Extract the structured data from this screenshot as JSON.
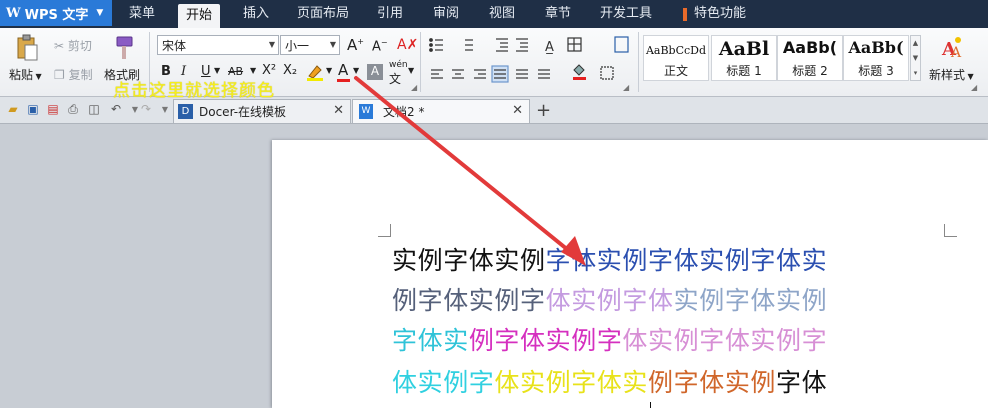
{
  "app": {
    "logo": "W",
    "name": "WPS 文字"
  },
  "menu": {
    "tabs": [
      "菜单",
      "开始",
      "插入",
      "页面布局",
      "引用",
      "审阅",
      "视图",
      "章节",
      "开发工具",
      "特色功能"
    ],
    "active": "开始"
  },
  "ribbon": {
    "clipboard": {
      "paste": "粘贴",
      "cut": "剪切",
      "copy": "复制",
      "format_painter": "格式刷"
    },
    "font": {
      "name": "宋体",
      "size": "小一",
      "bold": "B",
      "italic": "I",
      "underline": "U",
      "strike": "AB",
      "superscript": "X²",
      "subscript": "X₂",
      "font_color": "A",
      "char_shading": "A",
      "phonetic": "wén"
    },
    "styles": [
      {
        "sample": "AaBbCcDd",
        "name": "正文"
      },
      {
        "sample": "AaBl",
        "name": "标题 1"
      },
      {
        "sample": "AaBb(",
        "name": "标题 2"
      },
      {
        "sample": "AaBb(",
        "name": "标题 3"
      }
    ],
    "new_style": "新样式",
    "accent_color": "#2a7ad8"
  },
  "annotation": "点击这里就选择颜色",
  "doc_tabs": [
    {
      "label": "Docer-在线模板",
      "icon": "docer-icon"
    },
    {
      "label": "文档2 *",
      "icon": "word-doc-icon"
    }
  ],
  "document": {
    "lines": [
      [
        {
          "t": "实例字体实例",
          "c": "#111111"
        },
        {
          "t": "字体实例字体实例字体实",
          "c": "#2b4fb0"
        }
      ],
      [
        {
          "t": "例字体实例字",
          "c": "#55607a"
        },
        {
          "t": "体实例字体",
          "c": "#c49be0"
        },
        {
          "t": "实例字体实例",
          "c": "#8ea5c8"
        }
      ],
      [
        {
          "t": "字体实",
          "c": "#2fc3d8"
        },
        {
          "t": "例字体实例字",
          "c": "#d52fbf"
        },
        {
          "t": "体实例字体实例字",
          "c": "#d78fd5"
        }
      ],
      [
        {
          "t": "体实例字",
          "c": "#2fd0e0"
        },
        {
          "t": "体实例字体实",
          "c": "#e8e21a"
        },
        {
          "t": "例字体实例",
          "c": "#d0662a"
        },
        {
          "t": "字体",
          "c": "#111111"
        }
      ]
    ]
  }
}
